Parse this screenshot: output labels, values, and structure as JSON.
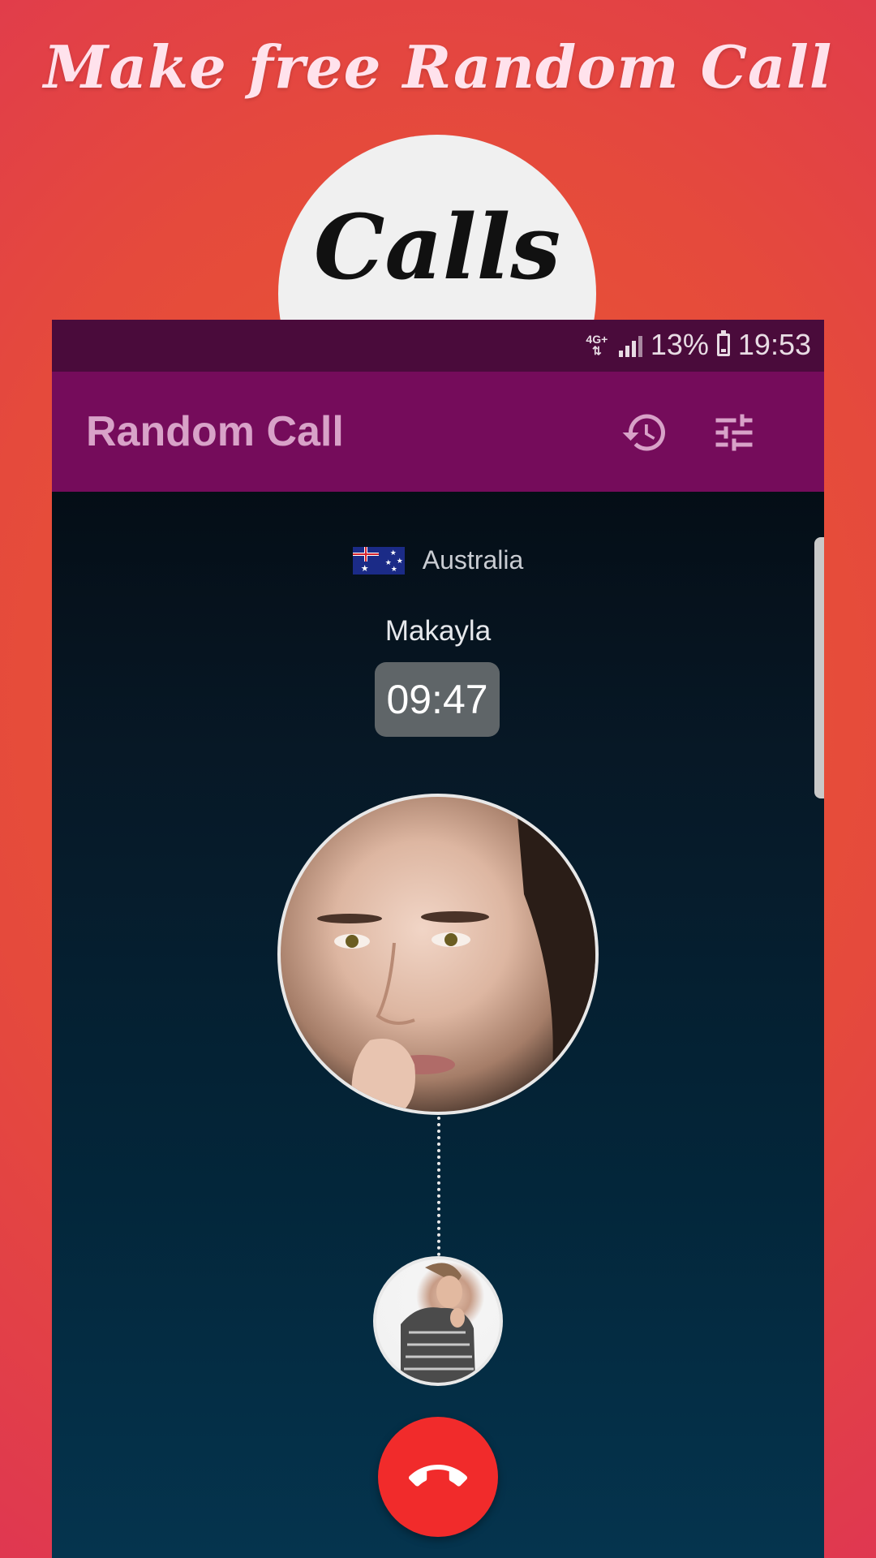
{
  "promo": {
    "headline": "Make free Random Call",
    "badge_label": "Calls"
  },
  "status_bar": {
    "network": "4G+",
    "battery_percent": "13%",
    "time": "19:53"
  },
  "app_bar": {
    "title": "Random Call",
    "icons": [
      "history-icon",
      "tune-icon"
    ]
  },
  "call": {
    "country": "Australia",
    "country_flag_icon": "australia-flag-icon",
    "caller_name": "Makayla",
    "duration": "09:47"
  },
  "controls": {
    "end_call_icon": "hang-up-icon"
  },
  "colors": {
    "status_bar": "#4a0b3b",
    "app_bar": "#750c5b",
    "app_title": "#d8a2c8",
    "hangup": "#f12b2b",
    "timer_bg": "#5f6568"
  }
}
